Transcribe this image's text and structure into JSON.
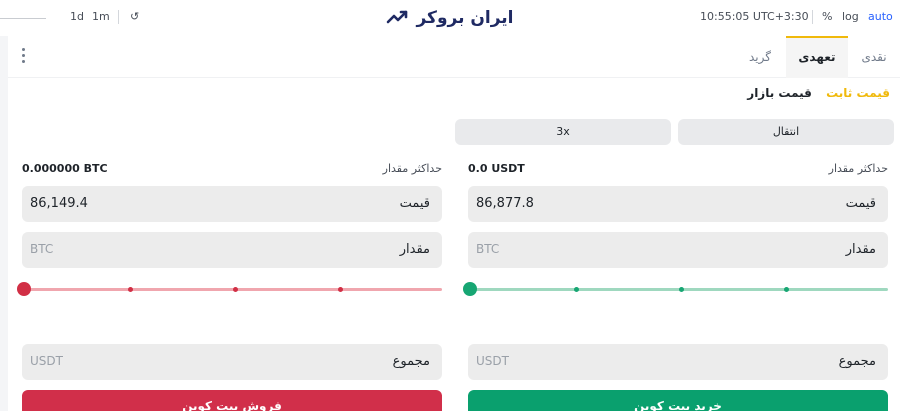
{
  "toolbar": {
    "interval_1": "1d",
    "interval_2": "1m",
    "undo_glyph": "↺",
    "time": "10:55:05 UTC+3:30",
    "percent": "%",
    "log": "log",
    "auto": "auto"
  },
  "brand": {
    "name": "ایران بروکر"
  },
  "tabs": [
    {
      "label": "نقدی"
    },
    {
      "label": "تعهدی"
    },
    {
      "label": "گرید"
    }
  ],
  "order_types": {
    "fixed": "قیمت ثابت",
    "market": "قیمت بازار"
  },
  "controls": {
    "transfer": "انتقال",
    "leverage": "3x"
  },
  "buy": {
    "max_label": "حداکثر مقدار",
    "max_value": "0.0 USDT",
    "price_label": "قیمت",
    "price_value": "86,877.8",
    "amount_label": "مقدار",
    "amount_placeholder": "BTC",
    "total_label": "مجموع",
    "total_placeholder": "USDT",
    "button": "خرید بیت کوین",
    "slider_percent": 0
  },
  "sell": {
    "max_label": "حداکثر مقدار",
    "max_value": "0.000000 BTC",
    "price_label": "قیمت",
    "price_value": "86,149.4",
    "amount_label": "مقدار",
    "amount_placeholder": "BTC",
    "total_label": "مجموع",
    "total_placeholder": "USDT",
    "button": "فروش بیت کوین",
    "slider_percent": 0
  },
  "colors": {
    "accent": "#f0b90b",
    "buy": "#0aa06e",
    "sell": "#d12f4a"
  }
}
